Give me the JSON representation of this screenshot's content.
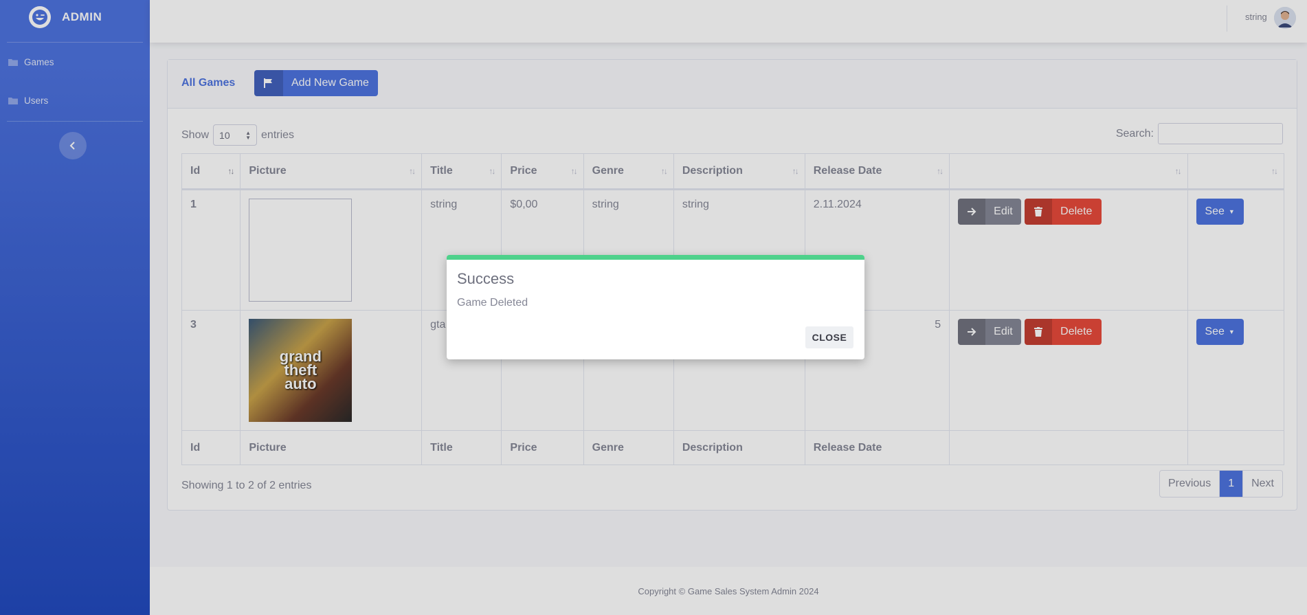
{
  "sidebar": {
    "brand": "ADMIN",
    "items": [
      {
        "label": "Games",
        "icon": "folder-icon"
      },
      {
        "label": "Users",
        "icon": "folder-icon"
      }
    ],
    "toggle_icon": "chevron-left-icon"
  },
  "topbar": {
    "user_name": "string"
  },
  "header": {
    "link": "All Games",
    "add_button": "Add New Game"
  },
  "controls": {
    "show_label": "Show",
    "entries_value": "10",
    "entries_label": "entries",
    "search_label": "Search:"
  },
  "table": {
    "columns": [
      "Id",
      "Picture",
      "Title",
      "Price",
      "Genre",
      "Description",
      "Release Date",
      "",
      ""
    ],
    "rows": [
      {
        "id": "1",
        "title": "string",
        "price": "$0,00",
        "genre": "string",
        "description": "string",
        "release_date": "2.11.2024",
        "picture": "broken"
      },
      {
        "id": "3",
        "title": "gta",
        "price": "",
        "genre": "",
        "description": "",
        "release_date": "5",
        "picture": "gta-cover"
      }
    ],
    "edit_label": "Edit",
    "delete_label": "Delete",
    "see_label": "See"
  },
  "gta_cover_text": [
    "grand",
    "theft",
    "auto"
  ],
  "footer_info": "Showing 1 to 2 of 2 entries",
  "pagination": {
    "prev": "Previous",
    "current": "1",
    "next": "Next"
  },
  "copyright": "Copyright © Game Sales System Admin 2024",
  "modal": {
    "title": "Success",
    "message": "Game Deleted",
    "close": "CLOSE",
    "accent": "#4ed18b"
  },
  "colors": {
    "primary": "#4e73df",
    "danger": "#e74a3b",
    "secondary": "#858796"
  }
}
